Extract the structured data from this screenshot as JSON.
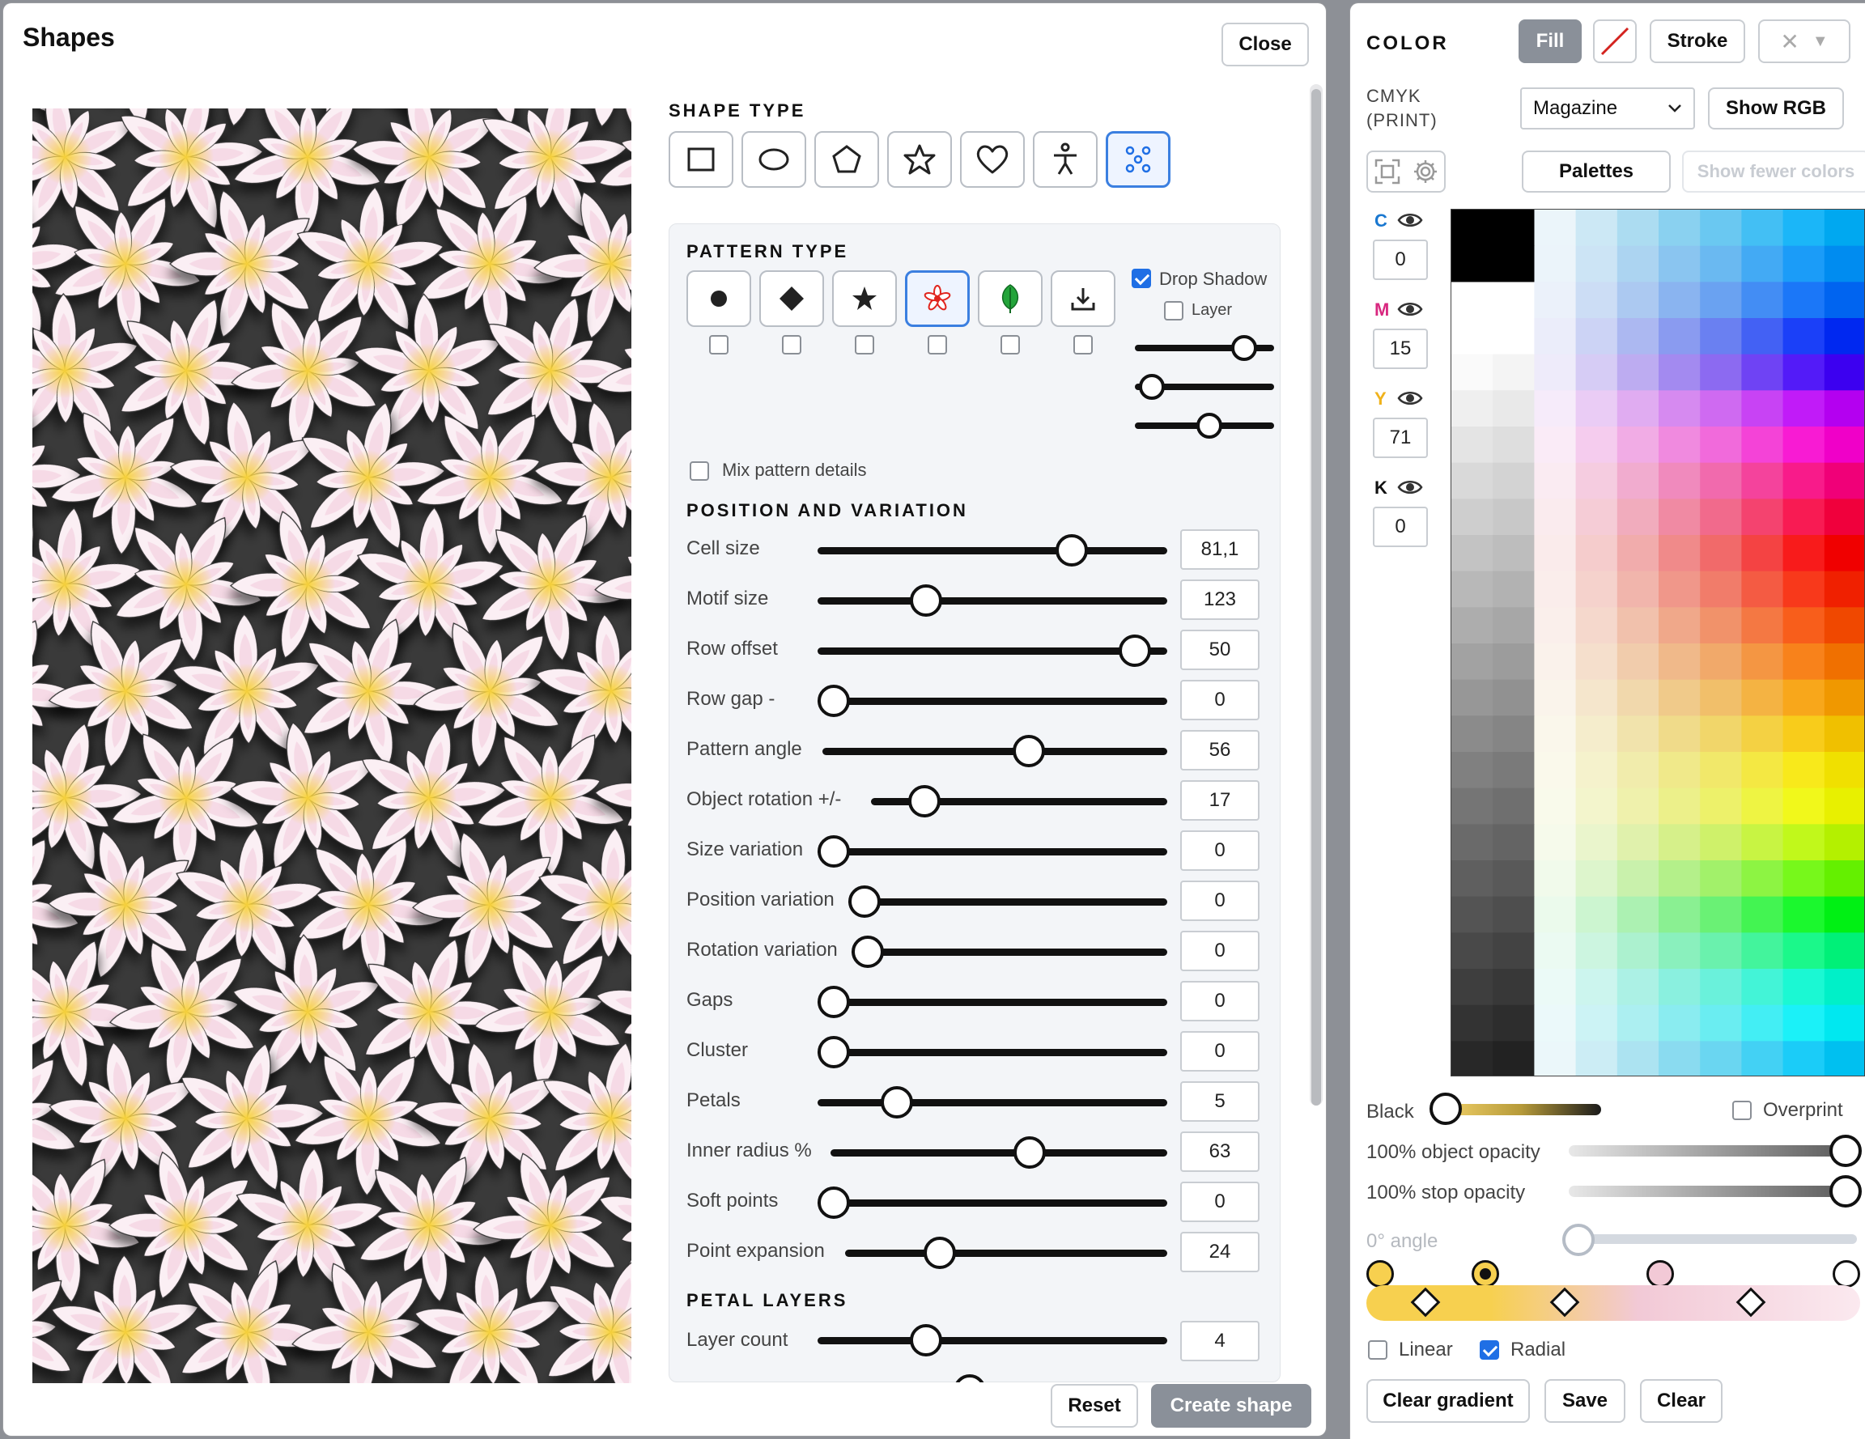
{
  "shapes_panel": {
    "title": "Shapes",
    "close_label": "Close",
    "shape_type_heading": "SHAPE TYPE",
    "shape_types": [
      "rectangle",
      "ellipse",
      "pentagon",
      "star",
      "heart",
      "person",
      "pattern"
    ],
    "selected_shape_type": "pattern",
    "pattern_type_heading": "PATTERN TYPE",
    "pattern_types": [
      "dot",
      "diamond",
      "star",
      "flower",
      "leaf",
      "download"
    ],
    "selected_pattern_type": "flower",
    "drop_shadow_label": "Drop Shadow",
    "drop_shadow_checked": true,
    "layer_label": "Layer",
    "layer_checked": false,
    "shadow_slider_levels": [
      0.85,
      0.05,
      0.55
    ],
    "mix_label": "Mix pattern details",
    "position_heading": "POSITION AND VARIATION",
    "sliders": [
      {
        "label": "Cell size",
        "value": "81,1",
        "level": 0.75
      },
      {
        "label": "Motif size",
        "value": "123",
        "level": 0.29
      },
      {
        "label": "Row offset",
        "value": "50",
        "level": 0.95
      },
      {
        "label": "Row gap -",
        "value": "0",
        "level": 0.0
      },
      {
        "label": "Pattern angle",
        "value": "56",
        "level": 0.61
      },
      {
        "label": "Object rotation +/-",
        "value": "17",
        "level": 0.14
      },
      {
        "label": "Size variation",
        "value": "0",
        "level": 0.0
      },
      {
        "label": "Position variation",
        "value": "0",
        "level": 0.0
      },
      {
        "label": "Rotation variation",
        "value": "0",
        "level": 0.0
      },
      {
        "label": "Gaps",
        "value": "0",
        "level": 0.0
      },
      {
        "label": "Cluster",
        "value": "0",
        "level": 0.0
      },
      {
        "label": "Petals",
        "value": "5",
        "level": 0.2
      },
      {
        "label": "Inner radius %",
        "value": "63",
        "level": 0.6
      },
      {
        "label": "Soft points",
        "value": "0",
        "level": 0.0
      },
      {
        "label": "Point expansion",
        "value": "24",
        "level": 0.27
      }
    ],
    "petal_heading": "PETAL LAYERS",
    "layer_count_label": "Layer count",
    "layer_count_value": "4",
    "layer_count_level": 0.29,
    "reset_label": "Reset",
    "create_label": "Create shape"
  },
  "color_panel": {
    "heading": "COLOR",
    "fill_label": "Fill",
    "stroke_label": "Stroke",
    "mode_label_1": "CMYK",
    "mode_label_2": "(PRINT)",
    "profile_value": "Magazine",
    "show_rgb_label": "Show RGB",
    "palettes_label": "Palettes",
    "show_fewer_label": "Show fewer colors",
    "channels": [
      {
        "letter": "C",
        "value": "0",
        "color": "#1a78d0"
      },
      {
        "letter": "M",
        "value": "15",
        "color": "#d8277f"
      },
      {
        "letter": "Y",
        "value": "71",
        "color": "#f0b21b"
      },
      {
        "letter": "K",
        "value": "0",
        "color": "#111111"
      }
    ],
    "black_label": "Black",
    "overprint_label": "Overprint",
    "object_opacity_label": "100% object opacity",
    "stop_opacity_label": "100% stop opacity",
    "angle_label": "0° angle",
    "linear_label": "Linear",
    "linear_checked": false,
    "radial_label": "Radial",
    "radial_checked": true,
    "clear_gradient_label": "Clear gradient",
    "save_label": "Save",
    "clear_label": "Clear",
    "accent_color": "#1f6fe5",
    "gradient_colors": [
      "#f7d04f",
      "#f2c9d6",
      "#fbe9ef"
    ]
  }
}
